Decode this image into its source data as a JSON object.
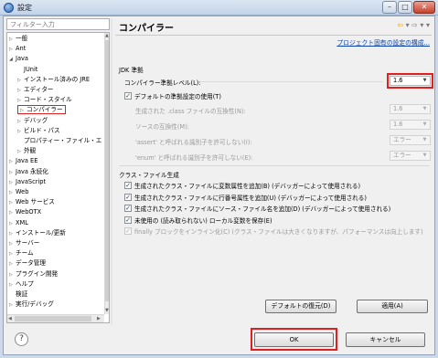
{
  "window": {
    "title": "設定"
  },
  "filter": {
    "placeholder": "フィルター入力"
  },
  "tree": [
    {
      "label": "一般",
      "arrow": "▷",
      "indent": 0
    },
    {
      "label": "Ant",
      "arrow": "▷",
      "indent": 0
    },
    {
      "label": "Java",
      "arrow": "◢",
      "indent": 0
    },
    {
      "label": "JUnit",
      "arrow": "",
      "indent": 1
    },
    {
      "label": "インストール済みの JRE",
      "arrow": "▷",
      "indent": 1
    },
    {
      "label": "エディター",
      "arrow": "▷",
      "indent": 1
    },
    {
      "label": "コード・スタイル",
      "arrow": "▷",
      "indent": 1
    },
    {
      "label": "コンパイラー",
      "arrow": "▷",
      "indent": 1,
      "selected": true
    },
    {
      "label": "デバッグ",
      "arrow": "▷",
      "indent": 1
    },
    {
      "label": "ビルド・パス",
      "arrow": "▷",
      "indent": 1
    },
    {
      "label": "プロパティー・ファイル・エ",
      "arrow": "",
      "indent": 1
    },
    {
      "label": "外観",
      "arrow": "▷",
      "indent": 1
    },
    {
      "label": "Java EE",
      "arrow": "▷",
      "indent": 0
    },
    {
      "label": "Java 永続化",
      "arrow": "▷",
      "indent": 0
    },
    {
      "label": "JavaScript",
      "arrow": "▷",
      "indent": 0
    },
    {
      "label": "Web",
      "arrow": "▷",
      "indent": 0
    },
    {
      "label": "Web サービス",
      "arrow": "▷",
      "indent": 0
    },
    {
      "label": "WebOTX",
      "arrow": "▷",
      "indent": 0
    },
    {
      "label": "XML",
      "arrow": "▷",
      "indent": 0
    },
    {
      "label": "インストール/更新",
      "arrow": "▷",
      "indent": 0
    },
    {
      "label": "サーバー",
      "arrow": "▷",
      "indent": 0
    },
    {
      "label": "チーム",
      "arrow": "▷",
      "indent": 0
    },
    {
      "label": "データ管理",
      "arrow": "▷",
      "indent": 0
    },
    {
      "label": "プラグイン開発",
      "arrow": "▷",
      "indent": 0
    },
    {
      "label": "ヘルプ",
      "arrow": "▷",
      "indent": 0
    },
    {
      "label": "検証",
      "arrow": "",
      "indent": 0
    },
    {
      "label": "実行/デバッグ",
      "arrow": "▷",
      "indent": 0
    }
  ],
  "page": {
    "title": "コンパイラー",
    "project_link": "プロジェクト固有の設定の構成...",
    "jdk_section": "JDK 準拠",
    "compliance_label": "コンパイラー準拠レベル(L):",
    "compliance_value": "1.6",
    "use_default_label": "デフォルトの準拠設定の使用(T)",
    "generated_class_label": "生成された .class ファイルの互換性(N):",
    "generated_class_value": "1.6",
    "source_compat_label": "ソースの互換性(M):",
    "source_compat_value": "1.6",
    "assert_label": "'assert' と呼ばれる識別子を許可しない(I):",
    "assert_value": "エラー",
    "enum_label": "'enum' と呼ばれる識別子を許可しない(E):",
    "enum_value": "エラー",
    "classfile_section": "クラス・ファイル生成",
    "checks": [
      {
        "label": "生成されたクラス・ファイルに変数属性を追加(B) (デバッガーによって使用される)",
        "checked": true,
        "disabled": false
      },
      {
        "label": "生成されたクラス・ファイルに行番号属性を追加(U) (デバッガーによって使用される)",
        "checked": true,
        "disabled": false
      },
      {
        "label": "生成されたクラス・ファイルにソース・ファイル名を追加(D) (デバッガーによって使用される)",
        "checked": true,
        "disabled": false
      },
      {
        "label": "未使用の (読み取られない) ローカル変数を保存(E)",
        "checked": true,
        "disabled": false
      },
      {
        "label": "finally ブロックをインライン化(C) (クラス・ファイルは大きくなりますが、パフォーマンスは向上します)",
        "checked": true,
        "disabled": true
      }
    ],
    "restore_defaults": "デフォルトの復元(D)",
    "apply": "適用(A)"
  },
  "footer": {
    "help": "?",
    "ok": "OK",
    "cancel": "キャンセル"
  },
  "colors": {
    "highlight": "#e02020",
    "link": "#0a3fa6"
  }
}
